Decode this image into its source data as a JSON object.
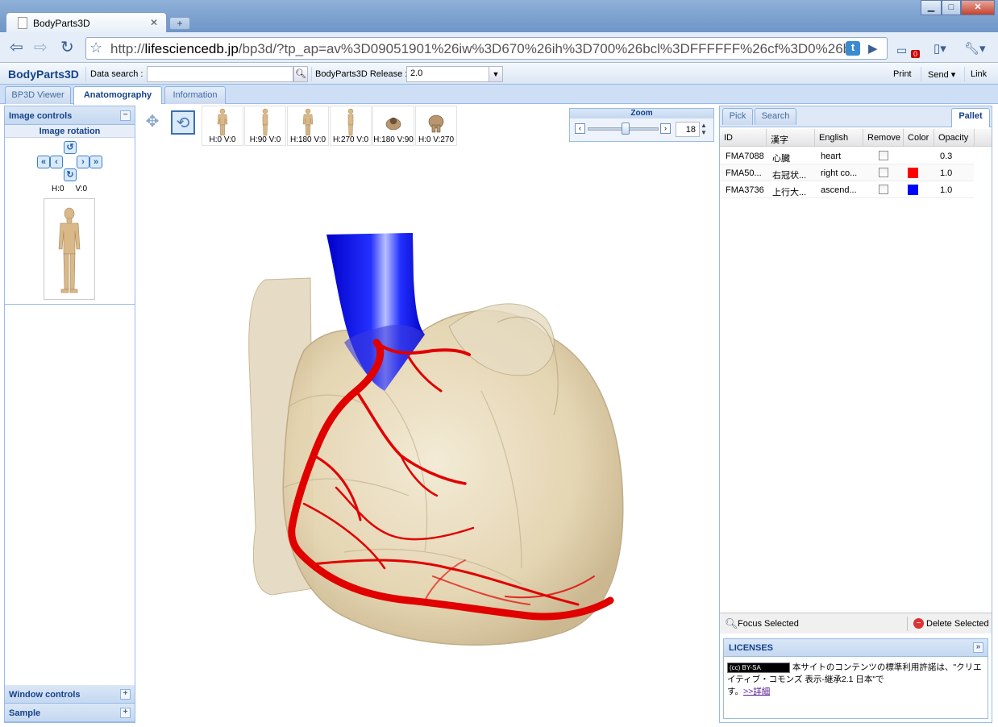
{
  "browser": {
    "tab_title": "BodyParts3D",
    "url_domain": "lifesciencedb.jp",
    "url_path": "/bp3d/?tp_ap=av%3D09051901%26iw%3D670%26ih%3D700%26bcl%3DFFFFFF%26cf%3D0%26bv%",
    "url_scheme": "http://",
    "extension_badge": "t",
    "notification_count": "0"
  },
  "app": {
    "brand": "BodyParts3D",
    "data_search_label": "Data search :",
    "search_placeholder": "",
    "release_label": "BodyParts3D Release :",
    "release_value": "2.0",
    "print": "Print",
    "send": "Send",
    "link": "Link"
  },
  "tabs": [
    "BP3D Viewer",
    "Anatomography",
    "Information"
  ],
  "left": {
    "image_controls": "Image controls",
    "image_rotation": "Image rotation",
    "rot_h": "H:0",
    "rot_v": "V:0",
    "window_controls": "Window controls",
    "sample": "Sample"
  },
  "viewer": {
    "presets": [
      "H:0 V:0",
      "H:90 V:0",
      "H:180 V:0",
      "H:270 V:0",
      "H:180 V:90",
      "H:0 V:270"
    ],
    "zoom_title": "Zoom",
    "zoom_value": "18"
  },
  "right": {
    "tabs": [
      "Pick",
      "Search",
      "Pallet"
    ],
    "columns": [
      "ID",
      "漢字",
      "English",
      "Remove",
      "Color",
      "Opacity"
    ],
    "rows": [
      {
        "id": "FMA7088",
        "kanji": "心臓",
        "english": "heart",
        "color": "",
        "opacity": "0.3"
      },
      {
        "id": "FMA50...",
        "kanji": "右冠状...",
        "english": "right co...",
        "color": "#ff0000",
        "opacity": "1.0"
      },
      {
        "id": "FMA3736",
        "kanji": "上行大...",
        "english": "ascend...",
        "color": "#0000ff",
        "opacity": "1.0"
      }
    ],
    "focus_selected": "Focus Selected",
    "delete_selected": "Delete Selected",
    "licenses_title": "LICENSES",
    "cc_badge": "(cc) BY-SA",
    "license_text_1": "本サイトのコンテンツの標準利用許諾は、\"クリエイティブ・コモンズ 表示-継承2.1 日本\"で",
    "license_text_2": "す。",
    "license_link": ">>詳細"
  }
}
